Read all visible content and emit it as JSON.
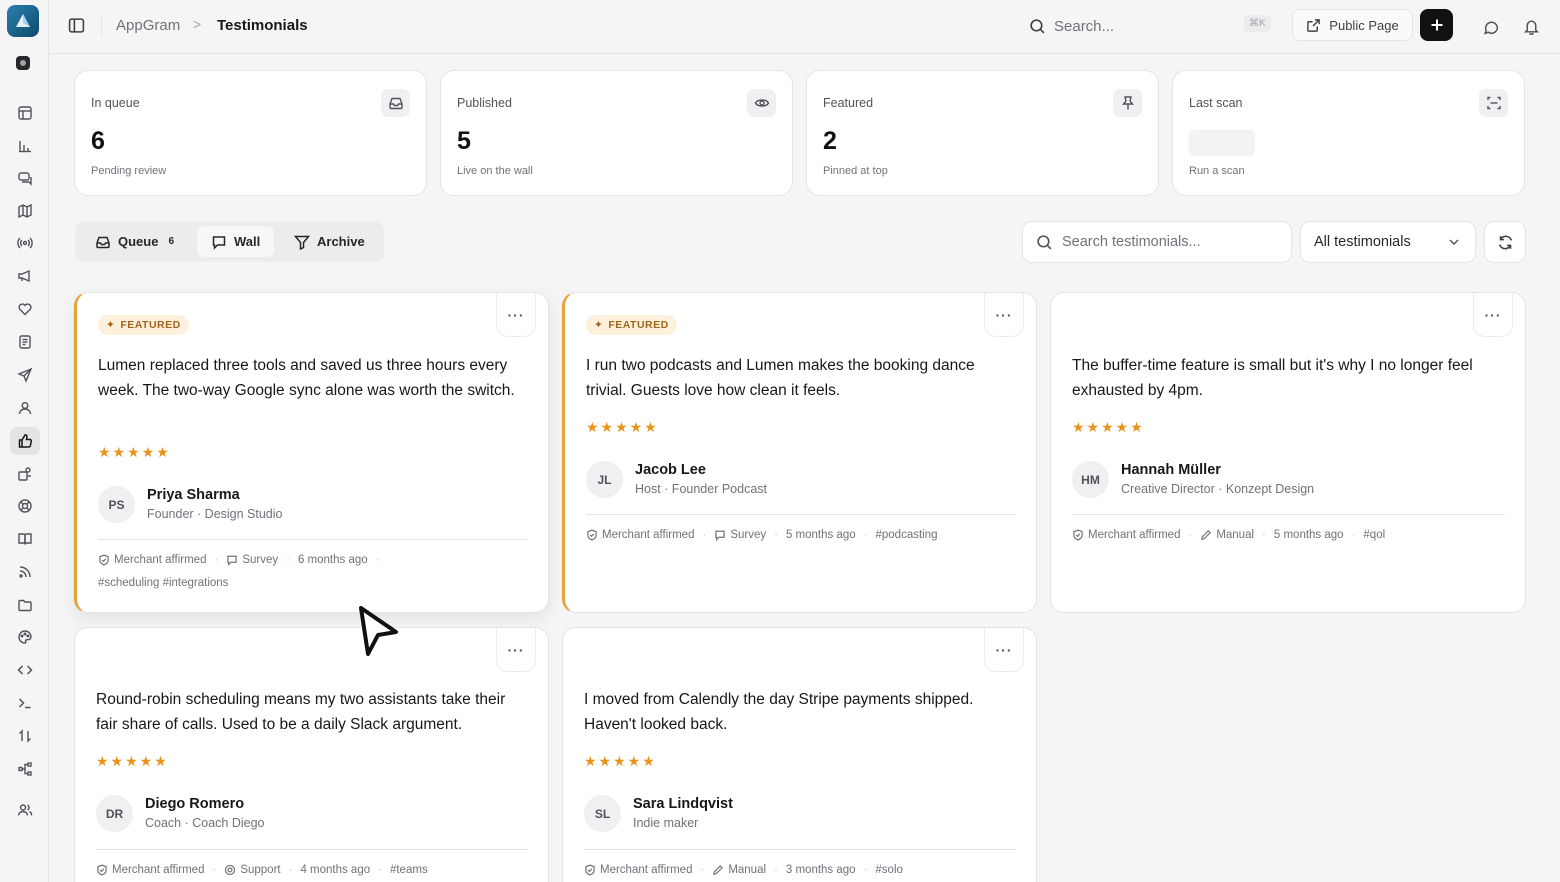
{
  "breadcrumb": {
    "root": "AppGram",
    "separator": ">",
    "current": "Testimonials"
  },
  "topbar": {
    "search_text": "Search...",
    "shortcut": "⌘K",
    "public_page": "Public Page"
  },
  "stats": [
    {
      "label": "In queue",
      "value": "6",
      "sub": "Pending review",
      "icon": "inbox-icon"
    },
    {
      "label": "Published",
      "value": "5",
      "sub": "Live on the wall",
      "icon": "eye-icon"
    },
    {
      "label": "Featured",
      "value": "2",
      "sub": "Pinned at top",
      "icon": "pin-icon"
    },
    {
      "label": "Last scan",
      "value": "",
      "sub": "Run a scan",
      "icon": "scan-icon"
    }
  ],
  "tabs": [
    {
      "label": "Queue",
      "count": "6"
    },
    {
      "label": "Wall",
      "count": ""
    },
    {
      "label": "Archive",
      "count": ""
    }
  ],
  "filters": {
    "search_placeholder": "Search testimonials...",
    "select_value": "All testimonials"
  },
  "testimonials": [
    {
      "badge": "FEATURED",
      "more": "···",
      "quote": "Lumen replaced three tools and saved us three hours every week. The two-way Google sync alone was worth the switch.",
      "stars": "★★★★★",
      "initials": "PS",
      "name": "Priya Sharma",
      "role": "Founder · Design Studio",
      "affirmed": "Merchant affirmed",
      "source": "Survey",
      "time": "6 months ago",
      "tags": "#scheduling #integrations"
    },
    {
      "badge": "FEATURED",
      "more": "···",
      "quote": "I run two podcasts and Lumen makes the booking dance trivial. Guests love how clean it feels.",
      "stars": "★★★★★",
      "initials": "JL",
      "name": "Jacob Lee",
      "role": "Host · Founder Podcast",
      "affirmed": "Merchant affirmed",
      "source": "Survey",
      "time": "5 months ago",
      "tags": "#podcasting"
    },
    {
      "badge": "",
      "more": "···",
      "quote": "The buffer-time feature is small but it's why I no longer feel exhausted by 4pm.",
      "stars": "★★★★★",
      "initials": "HM",
      "name": "Hannah Müller",
      "role": "Creative Director · Konzept Design",
      "affirmed": "Merchant affirmed",
      "source": "Manual",
      "time": "5 months ago",
      "tags": "#qol"
    },
    {
      "badge": "",
      "more": "···",
      "quote": "Round-robin scheduling means my two assistants take their fair share of calls. Used to be a daily Slack argument.",
      "stars": "★★★★★",
      "initials": "DR",
      "name": "Diego Romero",
      "role": "Coach · Coach Diego",
      "affirmed": "Merchant affirmed",
      "source": "Support",
      "time": "4 months ago",
      "tags": "#teams"
    },
    {
      "badge": "",
      "more": "···",
      "quote": "I moved from Calendly the day Stripe payments shipped. Haven't looked back.",
      "stars": "★★★★★",
      "initials": "SL",
      "name": "Sara Lindqvist",
      "role": "Indie maker",
      "affirmed": "Merchant affirmed",
      "source": "Manual",
      "time": "3 months ago",
      "tags": "#solo"
    }
  ],
  "colors": {
    "featured_accent": "#e8a23a",
    "star": "#e8941a",
    "primary_button": "#111111"
  }
}
